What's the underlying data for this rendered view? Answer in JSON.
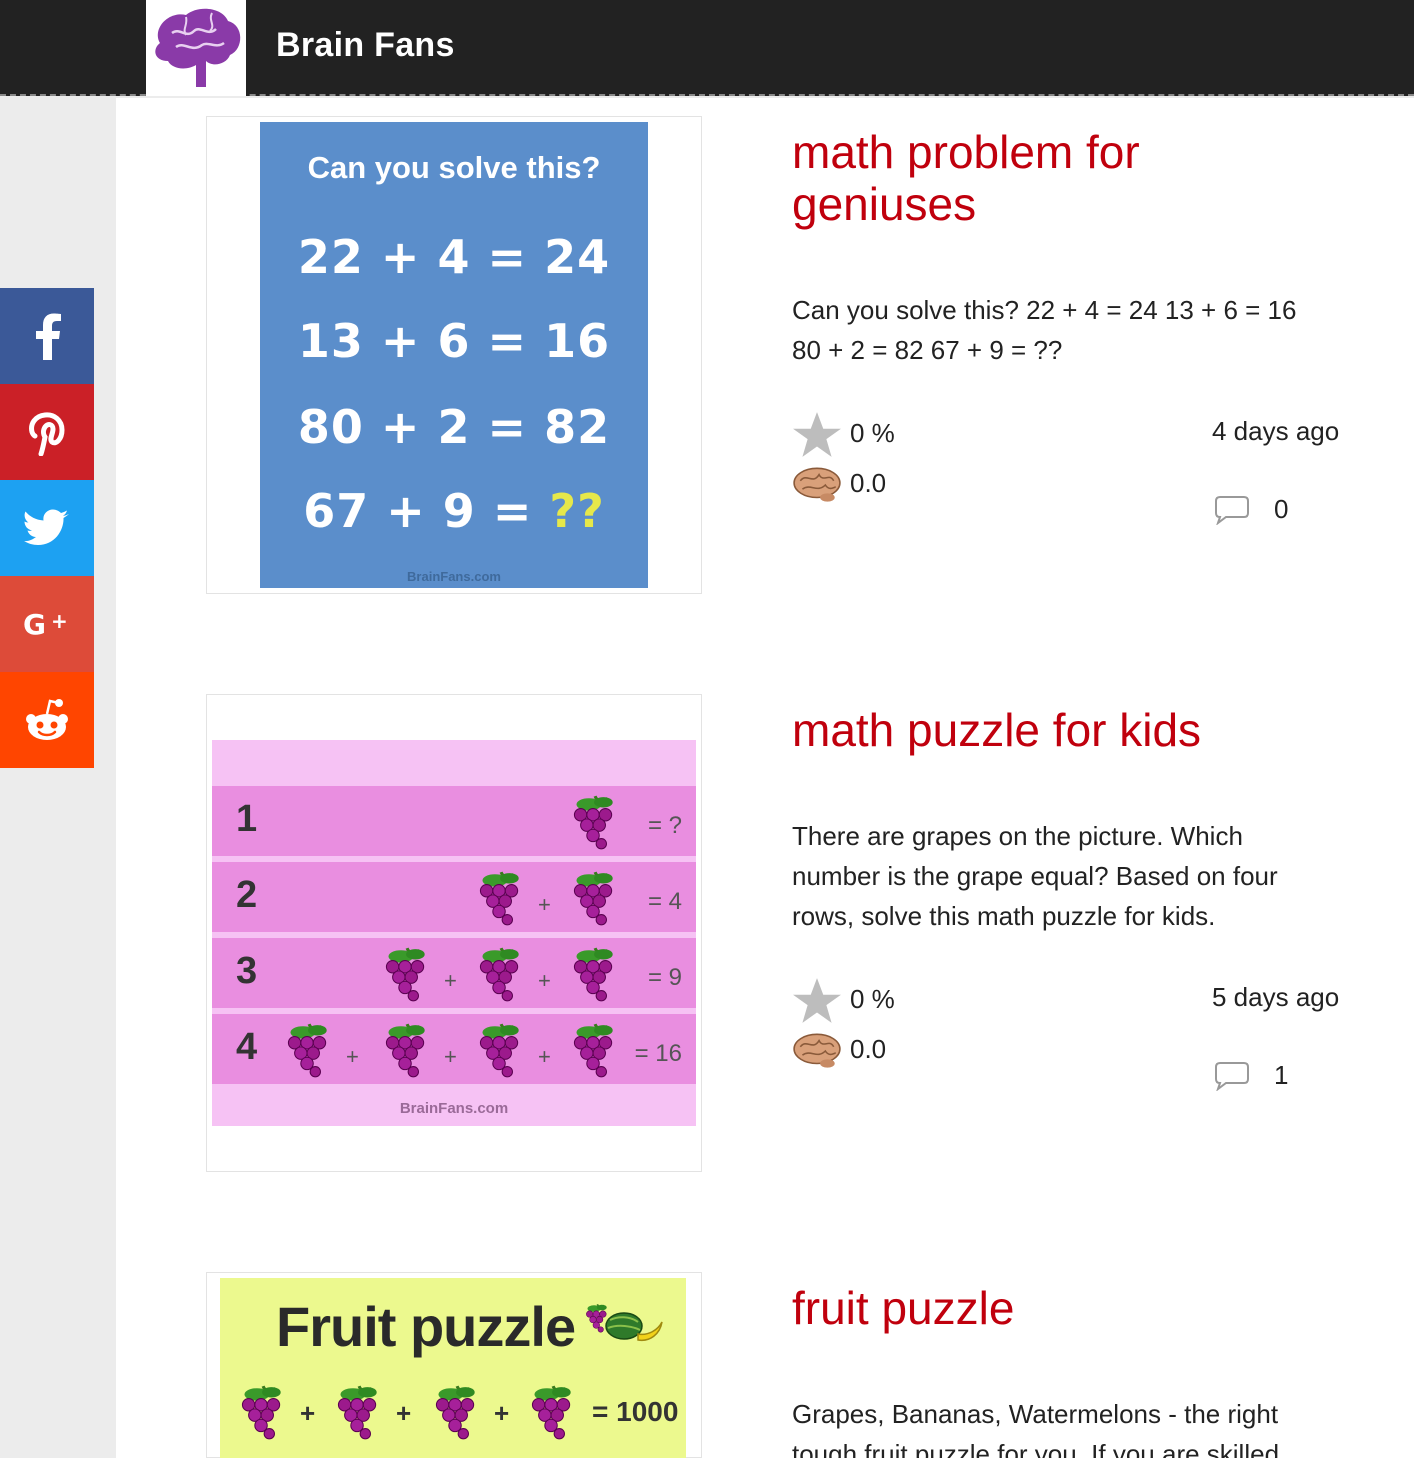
{
  "header": {
    "site_title": "Brain Fans"
  },
  "social": [
    "facebook-icon",
    "pinterest-icon",
    "twitter-icon",
    "google-plus-icon",
    "reddit-icon"
  ],
  "posts": [
    {
      "title_line1": "math problem for",
      "title_line2": "geniuses",
      "desc_line1": "Can you solve this? 22 + 4 = 24 13 + 6 = 16",
      "desc_line2": "80 + 2 = 82 67 + 9 = ??",
      "rating": "0 %",
      "difficulty": "0.0",
      "ago": "4 days ago",
      "comments": "0",
      "image": {
        "question": "Can you solve this?",
        "eq1": "22 + 4 = 24",
        "eq2": "13 + 6 = 16",
        "eq3": "80 + 2 = 82",
        "eq4_left": "67 + 9 = ",
        "eq4_right": "??",
        "watermark": "BrainFans.com"
      }
    },
    {
      "title": "math puzzle for kids",
      "desc_line1": "There are grapes on the picture. Which",
      "desc_line2": "number is the grape equal? Based on four",
      "desc_line3": "rows, solve this math puzzle for kids.",
      "rating": "0 %",
      "difficulty": "0.0",
      "ago": "5 days ago",
      "comments": "1",
      "image": {
        "row1_num": "1",
        "row1_rhs": "= ?",
        "row2_num": "2",
        "row2_rhs": "= 4",
        "row3_num": "3",
        "row3_rhs": "= 9",
        "row4_num": "4",
        "row4_rhs": "= 16",
        "plus": "+",
        "watermark": "BrainFans.com"
      }
    },
    {
      "title": "fruit puzzle",
      "desc_line1": "Grapes, Bananas, Watermelons - the right",
      "desc_line2": "tough fruit puzzle for you. If you are skilled",
      "image": {
        "heading": "Fruit puzzle",
        "plus": "+",
        "rhs": "= 1000"
      }
    }
  ],
  "colors": {
    "title_red": "#c0000d",
    "topbar": "#222222",
    "facebook": "#3b5998",
    "pinterest": "#cb2027",
    "twitter": "#1da1f2",
    "google_plus": "#dd4b39",
    "reddit": "#ff4500"
  }
}
